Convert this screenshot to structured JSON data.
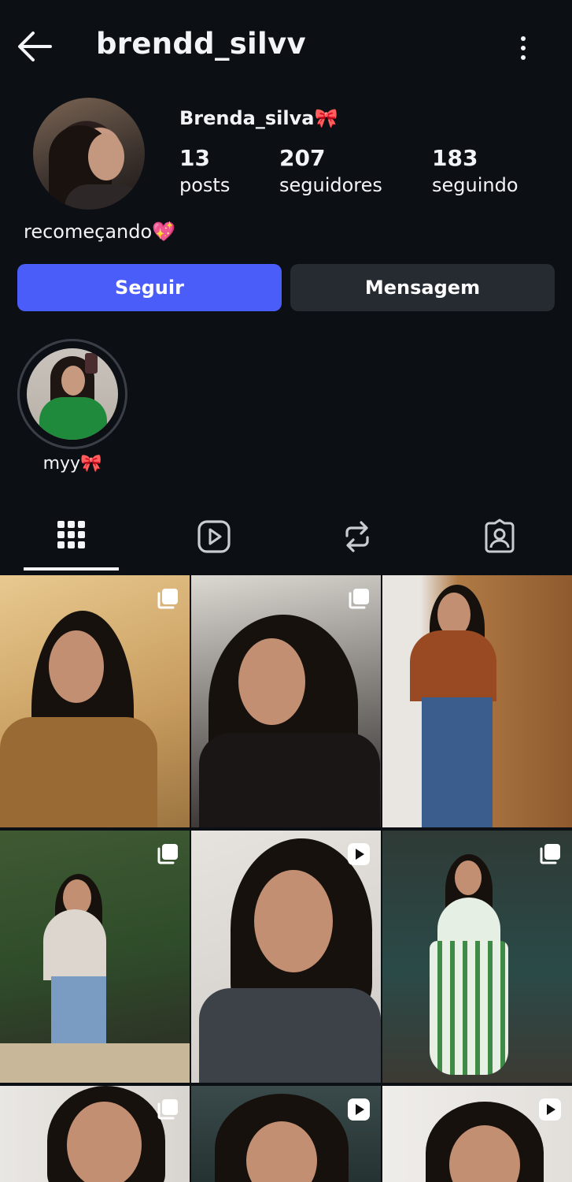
{
  "header": {
    "username": "brendd_silvv",
    "back_icon": "arrow-left-icon",
    "menu_icon": "more-vertical-icon"
  },
  "profile": {
    "display_name": "Brenda_silva🎀",
    "stats": [
      {
        "value": "13",
        "label": "posts"
      },
      {
        "value": "207",
        "label": "seguidores"
      },
      {
        "value": "183",
        "label": "seguindo"
      }
    ],
    "bio": "recomeçando💖"
  },
  "actions": {
    "follow_label": "Seguir",
    "message_label": "Mensagem"
  },
  "highlights": [
    {
      "label": "myy🎀"
    }
  ],
  "tabs": [
    {
      "name": "grid",
      "icon": "grid-icon",
      "active": true
    },
    {
      "name": "reels",
      "icon": "reels-icon",
      "active": false
    },
    {
      "name": "reposts",
      "icon": "repost-icon",
      "active": false
    },
    {
      "name": "tagged",
      "icon": "tagged-icon",
      "active": false
    }
  ],
  "posts": [
    {
      "type": "carousel",
      "icon": "carousel-icon"
    },
    {
      "type": "carousel",
      "icon": "carousel-icon"
    },
    {
      "type": "photo",
      "icon": ""
    },
    {
      "type": "carousel",
      "icon": "carousel-icon"
    },
    {
      "type": "reel",
      "icon": "reel-icon"
    },
    {
      "type": "carousel",
      "icon": "carousel-icon"
    },
    {
      "type": "carousel",
      "icon": "carousel-icon"
    },
    {
      "type": "reel",
      "icon": "reel-icon"
    },
    {
      "type": "reel",
      "icon": "reel-icon"
    }
  ],
  "colors": {
    "background": "#0c0f14",
    "follow_button": "#4a5df9",
    "message_button": "#262a31",
    "text": "#f2f4f7"
  }
}
